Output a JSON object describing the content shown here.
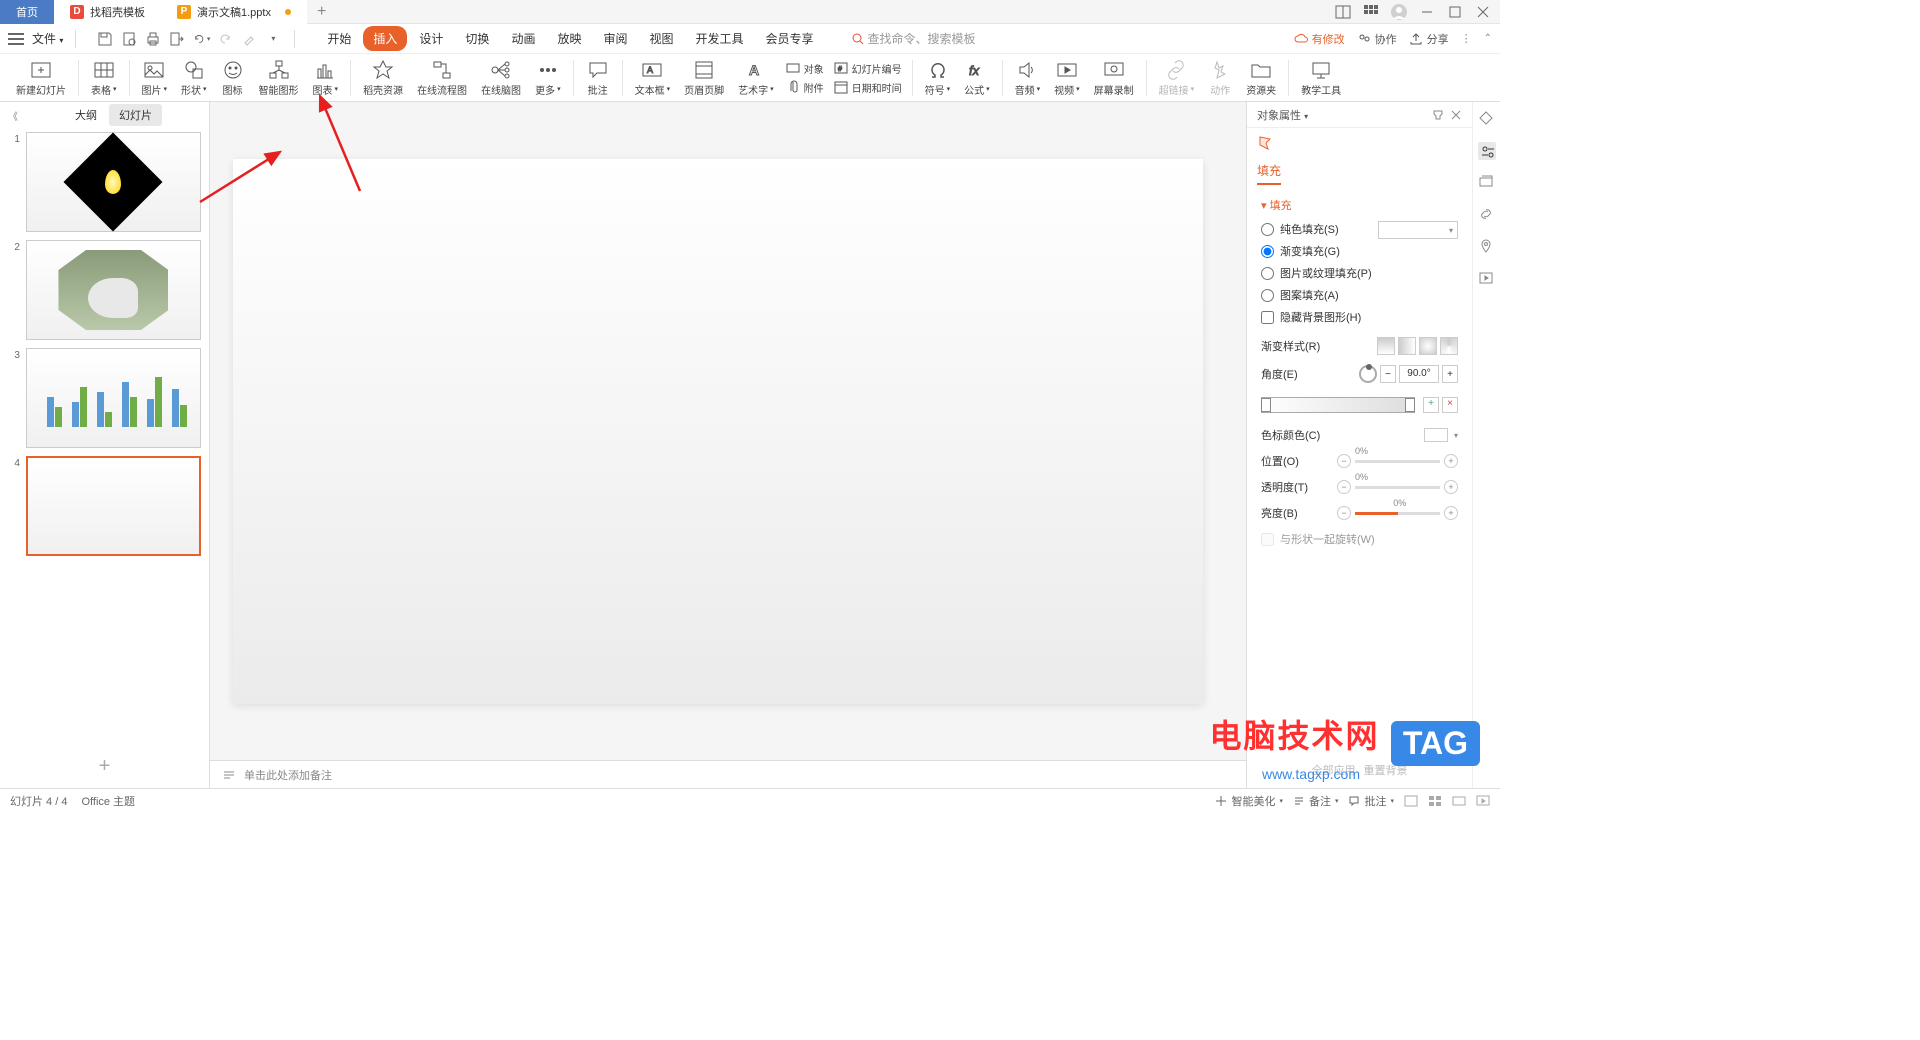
{
  "titlebar": {
    "home": "首页",
    "template": "找稻壳模板",
    "doc": "演示文稿1.pptx"
  },
  "menubar": {
    "file": "文件",
    "tabs": [
      "开始",
      "插入",
      "设计",
      "切换",
      "动画",
      "放映",
      "审阅",
      "视图",
      "开发工具",
      "会员专享"
    ],
    "active_tab": 1,
    "search_placeholder": "查找命令、搜索模板",
    "cloud_modified": "有修改",
    "collab": "协作",
    "share": "分享"
  },
  "ribbon": {
    "new_slide": "新建幻灯片",
    "table": "表格",
    "picture": "图片",
    "shapes": "形状",
    "icons": "图标",
    "smart_art": "智能图形",
    "chart": "图表",
    "resources": "稻壳资源",
    "online_flow": "在线流程图",
    "online_mind": "在线脑图",
    "more": "更多",
    "comment": "批注",
    "textbox": "文本框",
    "header_footer": "页眉页脚",
    "wordart": "艺术字",
    "object": "对象",
    "slide_num": "幻灯片编号",
    "attachment": "附件",
    "datetime": "日期和时间",
    "symbol": "符号",
    "equation": "公式",
    "audio": "音频",
    "video": "视频",
    "screen_rec": "屏幕录制",
    "hyperlink": "超链接",
    "action": "动作",
    "res_folder": "资源夹",
    "teaching": "教学工具"
  },
  "slide_panel": {
    "outline": "大纲",
    "slides": "幻灯片"
  },
  "notes": {
    "placeholder": "单击此处添加备注"
  },
  "right_panel": {
    "title": "对象属性",
    "tab_fill": "填充",
    "section_fill": "填充",
    "solid_fill": "纯色填充(S)",
    "gradient_fill": "渐变填充(G)",
    "pic_texture_fill": "图片或纹理填充(P)",
    "pattern_fill": "图案填充(A)",
    "hide_bg_shape": "隐藏背景图形(H)",
    "gradient_style": "渐变样式(R)",
    "angle": "角度(E)",
    "angle_val": "90.0°",
    "stop_color": "色标颜色(C)",
    "position": "位置(O)",
    "position_val": "0%",
    "transparency": "透明度(T)",
    "transparency_val": "0%",
    "brightness": "亮度(B)",
    "brightness_val": "0%",
    "rotate_with_shape": "与形状一起旋转(W)",
    "apply_all": "全部应用",
    "reset_bg": "重置背景"
  },
  "statusbar": {
    "slide_info": "幻灯片 4 / 4",
    "theme": "Office 主题",
    "beautify": "智能美化",
    "notes": "备注",
    "comments": "批注"
  },
  "watermark": {
    "cn": "电脑技术网",
    "url": "www.tagxp.com",
    "tag": "TAG"
  }
}
